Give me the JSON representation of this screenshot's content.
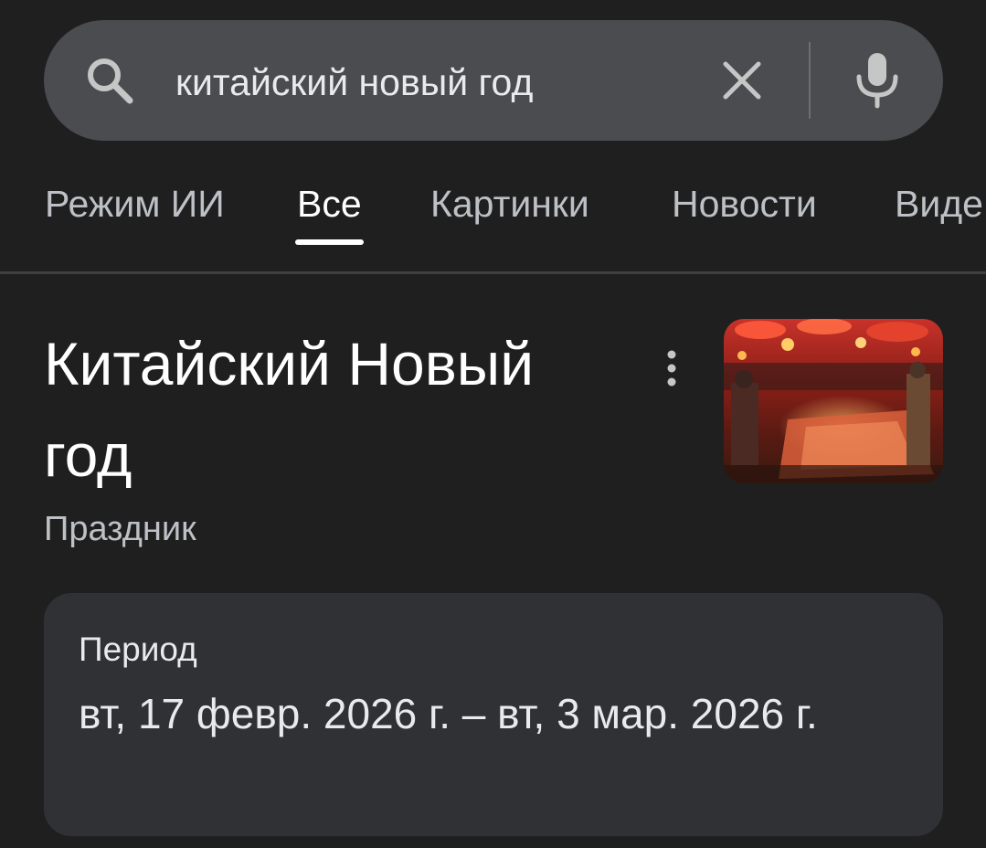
{
  "search": {
    "query": "китайский новый год",
    "icons": {
      "search": "search-icon",
      "clear": "close-icon",
      "voice": "mic-icon"
    }
  },
  "tabs": [
    {
      "label": "Режим ИИ",
      "active": false
    },
    {
      "label": "Все",
      "active": true
    },
    {
      "label": "Картинки",
      "active": false
    },
    {
      "label": "Новости",
      "active": false
    },
    {
      "label": "Виде",
      "active": false
    }
  ],
  "knowledge_panel": {
    "title": "Китайский Новый год",
    "subtitle": "Праздник",
    "image_icon": "festival-market-photo",
    "more_icon": "more-vert-icon"
  },
  "period_card": {
    "label": "Период",
    "value": "вт, 17 февр. 2026 г. – вт, 3 мар. 2026 г."
  },
  "colors": {
    "background": "#1f1f1f",
    "search_bar": "#4a4c50",
    "card": "#303134",
    "text_primary": "#e8eaed",
    "text_secondary": "#bdc1c6",
    "active_tab": "#ffffff"
  }
}
